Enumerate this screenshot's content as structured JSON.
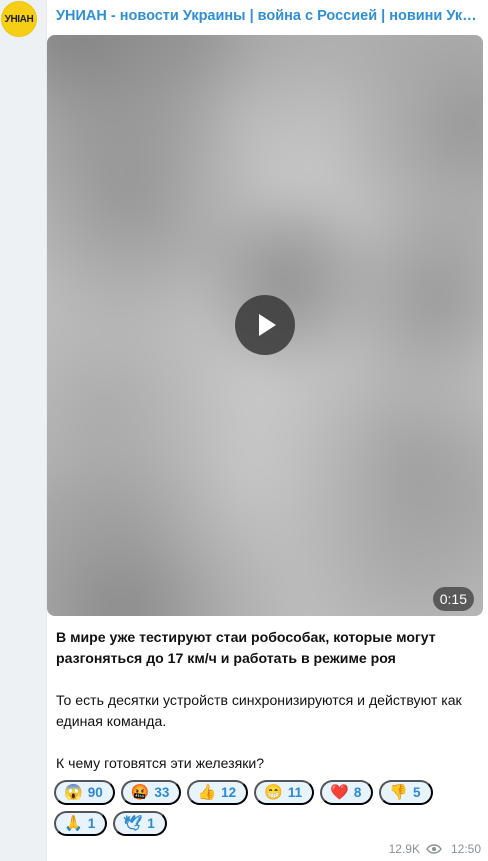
{
  "channel": {
    "title": "УНИАН - новости Украины | война с Россией | новини України…",
    "avatar_text": "УНІАН"
  },
  "media": {
    "duration": "0:15",
    "play_icon": "play-icon"
  },
  "post": {
    "lead": "В мире уже тестируют стаи робособак, которые могут разгоняться до 17 км/ч и работать в режиме роя",
    "paragraph_2": "То есть десятки устройств синхронизируются и действуют как единая команда.",
    "paragraph_3": "К чему готовятся эти железяки?"
  },
  "reactions": [
    {
      "emoji": "😱",
      "count": "90"
    },
    {
      "emoji": "🤬",
      "count": "33"
    },
    {
      "emoji": "👍",
      "count": "12"
    },
    {
      "emoji": "😁",
      "count": "11"
    },
    {
      "emoji": "❤️",
      "count": "8"
    },
    {
      "emoji": "👎",
      "count": "5"
    },
    {
      "emoji": "🙏",
      "count": "1"
    },
    {
      "emoji": "🕊",
      "count": "1"
    }
  ],
  "footer": {
    "views": "12.9K",
    "time": "12:50",
    "views_icon": "eye-icon"
  },
  "colors": {
    "link_blue": "#2f8fd4",
    "reaction_bg": "#e7f3fd",
    "reaction_text": "#2e89d1",
    "avatar_yellow": "#f6cf15"
  }
}
